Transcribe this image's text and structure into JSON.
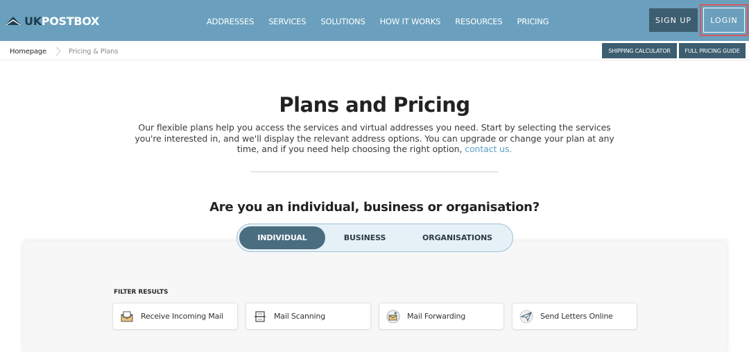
{
  "header": {
    "logo_uk": "UK",
    "logo_rest": "POSTBOX",
    "nav": [
      "ADDRESSES",
      "SERVICES",
      "SOLUTIONS",
      "HOW IT WORKS",
      "RESOURCES",
      "PRICING"
    ],
    "signup_label": "SIGN UP",
    "login_label": "LOGIN"
  },
  "breadcrumb": {
    "home": "Homepage",
    "current": "Pricing & Plans"
  },
  "utility": {
    "shipping_calculator": "SHIPPING CALCULATOR",
    "full_pricing_guide": "FULL PRICING GUIDE"
  },
  "hero": {
    "title": "Plans and Pricing",
    "intro": "Our flexible plans help you access the services and virtual addresses you need. Start by selecting the services you're interested in, and we'll display the relevant address options. You can upgrade or change your plan at any time, and if you need help choosing the right option,",
    "intro_link": "contact us."
  },
  "audience": {
    "question": "Are you an individual, business or organisation?",
    "options": [
      "INDIVIDUAL",
      "BUSINESS",
      "ORGANISATIONS"
    ],
    "selected": "INDIVIDUAL"
  },
  "filters": {
    "label": "FILTER RESULTS",
    "items": [
      {
        "label": "Receive Incoming Mail",
        "icon": "envelope-inbox-icon"
      },
      {
        "label": "Mail Scanning",
        "icon": "scanner-icon"
      },
      {
        "label": "Mail Forwarding",
        "icon": "forward-mail-icon"
      },
      {
        "label": "Send Letters Online",
        "icon": "paper-plane-icon"
      }
    ]
  },
  "colors": {
    "header_bg": "#6aa0bd",
    "dark_button": "#3d5d70",
    "accent_link": "#5a9fc2",
    "login_highlight": "#d3595f"
  }
}
